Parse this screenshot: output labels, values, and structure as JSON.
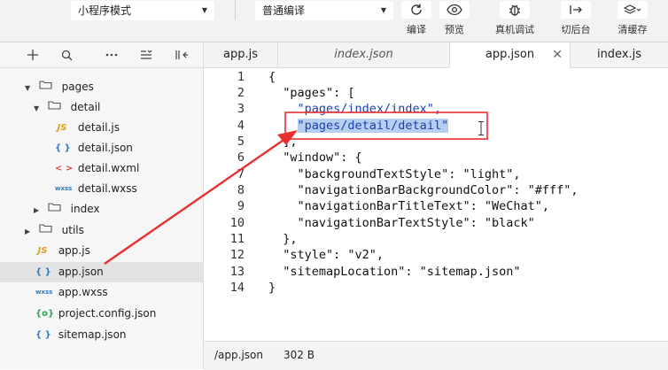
{
  "toolbar": {
    "mode_select": "小程序模式",
    "compile_select": "普通编译",
    "buttons": {
      "compile": "编译",
      "preview": "预览",
      "remote_debug": "真机调试",
      "background": "切后台",
      "clear_cache": "清缓存"
    }
  },
  "explorer": {
    "items": [
      {
        "label": "pages",
        "type": "folder"
      },
      {
        "label": "detail",
        "type": "folder"
      },
      {
        "label": "detail.js",
        "type": "js"
      },
      {
        "label": "detail.json",
        "type": "json"
      },
      {
        "label": "detail.wxml",
        "type": "wxml"
      },
      {
        "label": "detail.wxss",
        "type": "wxss"
      },
      {
        "label": "index",
        "type": "folder"
      },
      {
        "label": "utils",
        "type": "folder"
      },
      {
        "label": "app.js",
        "type": "js"
      },
      {
        "label": "app.json",
        "type": "json",
        "selected": true
      },
      {
        "label": "app.wxss",
        "type": "wxss"
      },
      {
        "label": "project.config.json",
        "type": "config"
      },
      {
        "label": "sitemap.json",
        "type": "json"
      }
    ],
    "icon_glyphs": {
      "js": "JS",
      "json": "{ }",
      "wxml": "< >",
      "wxss": "wxss",
      "config": "{o}"
    }
  },
  "tabs": [
    "app.js",
    "index.json",
    "app.json",
    "index.js"
  ],
  "code": {
    "line_numbers": [
      "1",
      "2",
      "3",
      "4",
      "5",
      "6",
      "7",
      "8",
      "9",
      "10",
      "11",
      "12",
      "13",
      "14"
    ],
    "lines": [
      "{",
      "  \"pages\": [",
      "    \"pages/index/index\",",
      "    \"pages/detail/detail\"",
      "  ],",
      "  \"window\": {",
      "    \"backgroundTextStyle\": \"light\",",
      "    \"navigationBarBackgroundColor\": \"#fff\",",
      "    \"navigationBarTitleText\": \"WeChat\",",
      "    \"navigationBarTextStyle\": \"black\"",
      "  },",
      "  \"style\": \"v2\",",
      "  \"sitemapLocation\": \"sitemap.json\"",
      "}"
    ]
  },
  "status": {
    "path": "/app.json",
    "size": "302 B"
  },
  "colors": {
    "annotation": "#e8302f",
    "selection": "#b6cff0",
    "string": "#1c3fae"
  }
}
